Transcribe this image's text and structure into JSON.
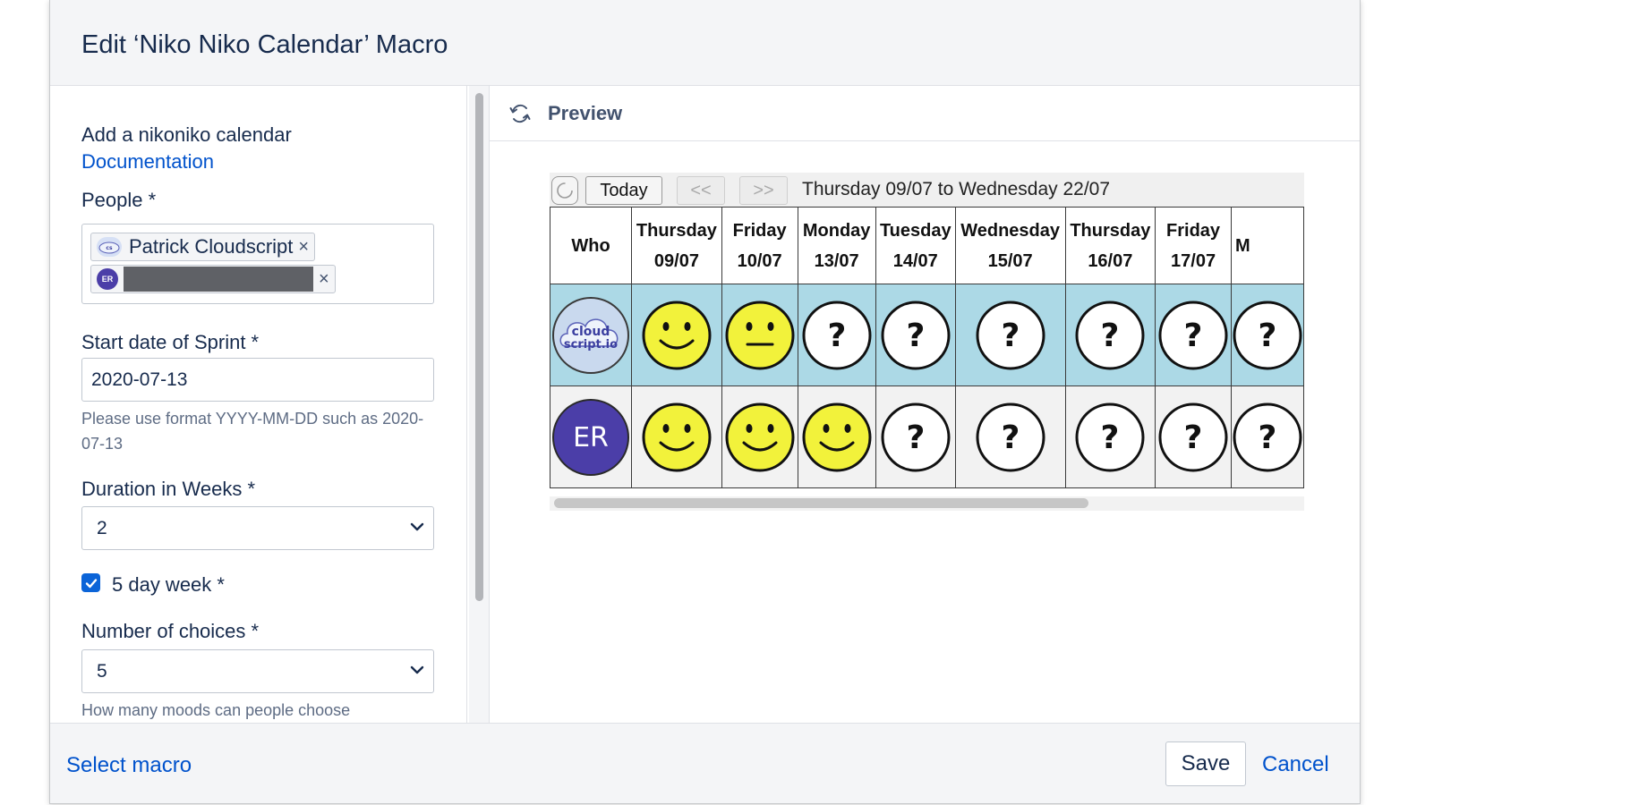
{
  "dialog": {
    "title": "Edit ‘Niko Niko Calendar’ Macro",
    "footer": {
      "select_macro": "Select macro",
      "save": "Save",
      "cancel": "Cancel"
    }
  },
  "form": {
    "description": "Add a nikoniko calendar",
    "documentation_link": "Documentation",
    "people": {
      "label": "People *",
      "chips": [
        {
          "label": "Patrick Cloudscript",
          "avatar": "cloudscript-logo"
        },
        {
          "label": "",
          "avatar_initials": "ER",
          "redacted": true
        }
      ]
    },
    "start_date": {
      "label": "Start date of Sprint *",
      "value": "2020-07-13",
      "help": "Please use format YYYY-MM-DD such as 2020-07-13"
    },
    "duration": {
      "label": "Duration in Weeks *",
      "value": "2"
    },
    "five_day_week": {
      "label": "5 day week *",
      "checked": true
    },
    "choices": {
      "label": "Number of choices *",
      "value": "5",
      "help": "How many moods can people choose"
    }
  },
  "preview": {
    "title": "Preview",
    "toolbar": {
      "today": "Today",
      "prev": "<<",
      "next": ">>",
      "range": "Thursday 09/07 to Wednesday 22/07"
    },
    "calendar": {
      "who_header": "Who",
      "columns": [
        {
          "day": "Thursday",
          "date": "09/07"
        },
        {
          "day": "Friday",
          "date": "10/07"
        },
        {
          "day": "Monday",
          "date": "13/07"
        },
        {
          "day": "Tuesday",
          "date": "14/07"
        },
        {
          "day": "Wednesday",
          "date": "15/07"
        },
        {
          "day": "Thursday",
          "date": "16/07"
        },
        {
          "day": "Friday",
          "date": "17/07"
        },
        {
          "day": "M",
          "date": ""
        }
      ],
      "rows": [
        {
          "avatar_label_1": "cloud",
          "avatar_label_2": "script.io",
          "moods": [
            "happy",
            "neutral",
            "unknown",
            "unknown",
            "unknown",
            "unknown",
            "unknown",
            "unknown"
          ]
        },
        {
          "avatar_initials": "ER",
          "moods": [
            "happy",
            "happy",
            "happy",
            "unknown",
            "unknown",
            "unknown",
            "unknown",
            "unknown"
          ]
        }
      ]
    }
  },
  "colors": {
    "link": "#0052cc",
    "row_highlight": "#acd9e6",
    "avatar_purple": "#4b3ea8",
    "face_yellow": "#f2f23b"
  }
}
